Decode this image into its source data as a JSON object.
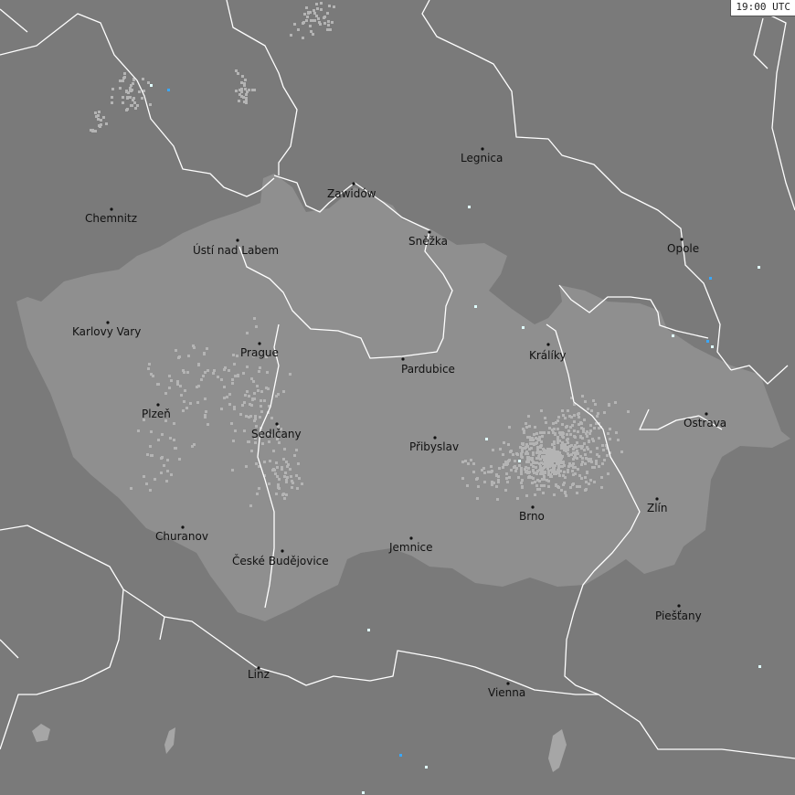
{
  "timestamp": "19:00 UTC",
  "cities": [
    {
      "name": "Chemnitz"
    },
    {
      "name": "Zawidów"
    },
    {
      "name": "Legnica"
    },
    {
      "name": "Ústí nad Labem"
    },
    {
      "name": "Sněžka"
    },
    {
      "name": "Opole"
    },
    {
      "name": "Karlovy Vary"
    },
    {
      "name": "Prague"
    },
    {
      "name": "Králíky"
    },
    {
      "name": "Pardubice"
    },
    {
      "name": "Plzeň"
    },
    {
      "name": "Sedlčany"
    },
    {
      "name": "Ostrava"
    },
    {
      "name": "Přibyslav"
    },
    {
      "name": "Zlín"
    },
    {
      "name": "Brno"
    },
    {
      "name": "Churanov"
    },
    {
      "name": "České Budějovice"
    },
    {
      "name": "Jemnice"
    },
    {
      "name": "Piešťany"
    },
    {
      "name": "Linz"
    },
    {
      "name": "Vienna"
    }
  ],
  "colors": {
    "background": "#7a7a7a",
    "region": "#8f8f8f",
    "borders": "#ffffff",
    "lakes": "#a6a6a6",
    "strike_density": "#b4b4b4",
    "strike_recent": "#3aa8ff",
    "strike_fresh": "#e0ffff"
  }
}
